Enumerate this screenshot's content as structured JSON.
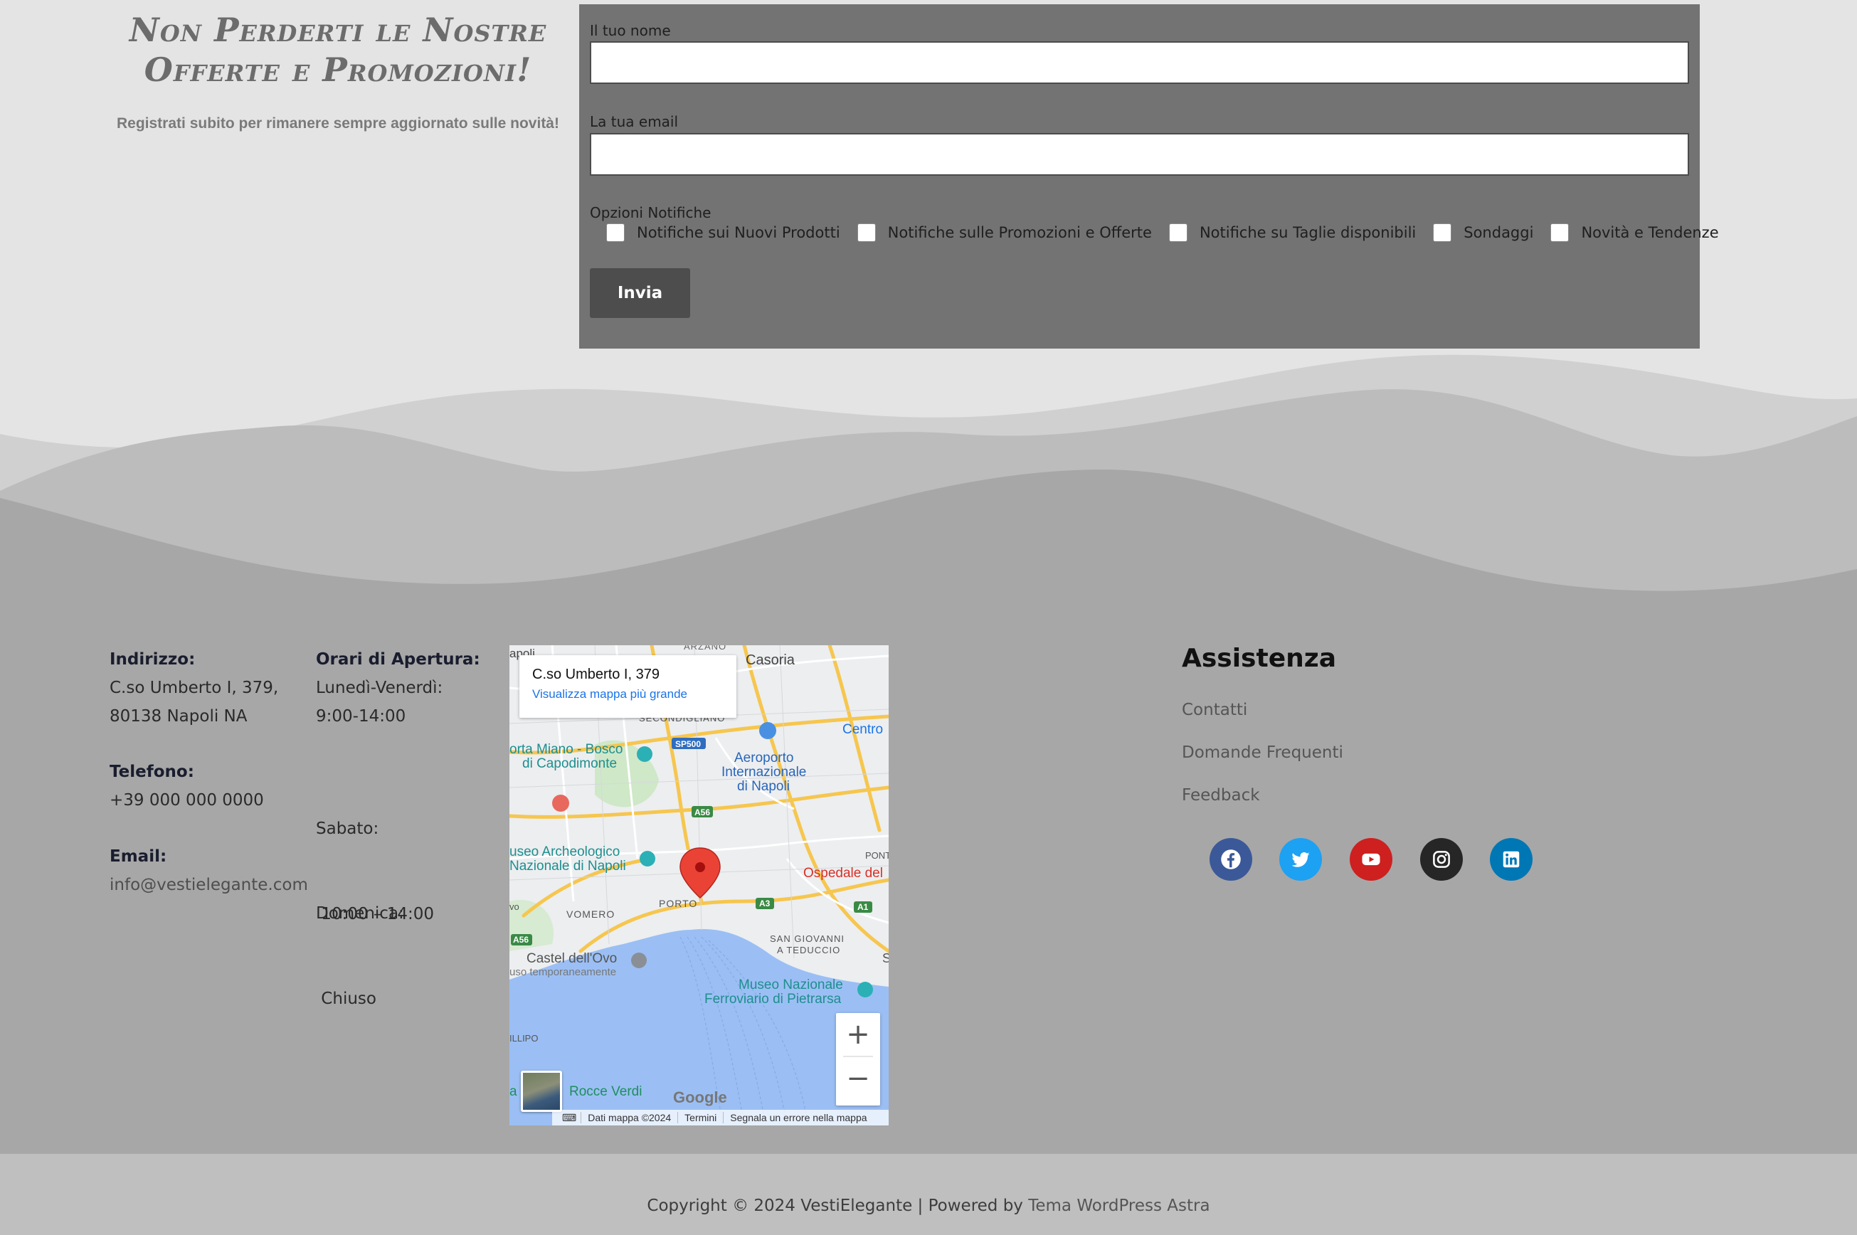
{
  "newsletter": {
    "title": "Non Perderti le Nostre Offerte e Promozioni!",
    "subtitle": "Registrati subito per rimanere sempre aggiornato sulle novità!",
    "form": {
      "name_label": "Il tuo nome",
      "name_value": "",
      "email_label": "La tua email",
      "email_value": "",
      "options_label": "Opzioni Notifiche",
      "options": [
        "Notifiche sui Nuovi Prodotti",
        "Notifiche sulle Promozioni e Offerte",
        "Notifiche su Taglie disponibili",
        "Sondaggi",
        "Novità e Tendenze"
      ],
      "submit_label": "Invia"
    }
  },
  "contact": {
    "address_heading": "Indirizzo:",
    "address_line1": "C.so Umberto I, 379,",
    "address_line2": "80138 Napoli NA",
    "phone_heading": "Telefono:",
    "phone": "+39 000 000 0000",
    "email_heading": "Email:",
    "email": "info@vestielegante.com"
  },
  "hours": {
    "heading": "Orari di Apertura:",
    "weekdays_label": "Lunedì-Venerdì:",
    "weekdays_hours": "9:00-14:00",
    "saturday_label": "Sabato:",
    "saturday_hours": " 10:00 – 14:00",
    "sunday_label": "Domenica:",
    "sunday_hours": " Chiuso"
  },
  "map": {
    "card_title": "C.so Umberto I, 379",
    "card_link": "Visualizza mappa più grande",
    "zoom_in": "+",
    "zoom_out": "−",
    "google_logo": "Google",
    "attribution": [
      "Dati mappa ©2024",
      "Termini",
      "Segnala un errore nella mappa"
    ],
    "places": {
      "casoria": "Casoria",
      "secondigliano": "SECONDIGLIANO",
      "capodimonte": "orta Miano - Bosco di Capodimonte",
      "capodimonte_l1": "orta Miano - Bosco",
      "capodimonte_l2": "di Capodimonte",
      "aeroporto_l1": "Aeroporto",
      "aeroporto_l2": "Internazionale",
      "aeroporto_l3": "di Napoli",
      "centro": "Centro",
      "museo_l1": "useo Archeologico",
      "museo_l2": "Nazionale di Napoli",
      "ospedale": "Ospedale del",
      "vomero": "VOMERO",
      "porto": "PORTO",
      "pontic": "PONTI",
      "castel_l1": "Castel dell'Ovo",
      "castel_l2": "uso temporaneamente",
      "sangiovanni_l1": "SAN GIOVANNI",
      "sangiovanni_l2": "A TEDUCCIO",
      "pietrarsa_l1": "Museo Nazionale",
      "pietrarsa_l2": "Ferroviario di Pietrarsa",
      "posillipo": "ILLIPO",
      "rocce": "Rocce Verdi",
      "apoli": "apoli",
      "vo": "vo",
      "arzano": "ARZANO",
      "s": "S",
      "la": "a",
      "road_sp500": "SP500",
      "road_a56": "A56",
      "road_a56b": "A56",
      "road_a3": "A3",
      "road_a1": "A1"
    }
  },
  "assistance": {
    "title": "Assistenza",
    "links": [
      "Contatti",
      "Domande Frequenti",
      "Feedback"
    ]
  },
  "social": {
    "facebook_color": "#3b5998",
    "twitter_color": "#1da1f2",
    "youtube_color": "#cd201f",
    "instagram_color": "#262626",
    "linkedin_color": "#0077b5"
  },
  "copyright": {
    "prefix": "Copyright © 2024 VestiElegante | Powered by ",
    "link": "Tema WordPress Astra"
  }
}
